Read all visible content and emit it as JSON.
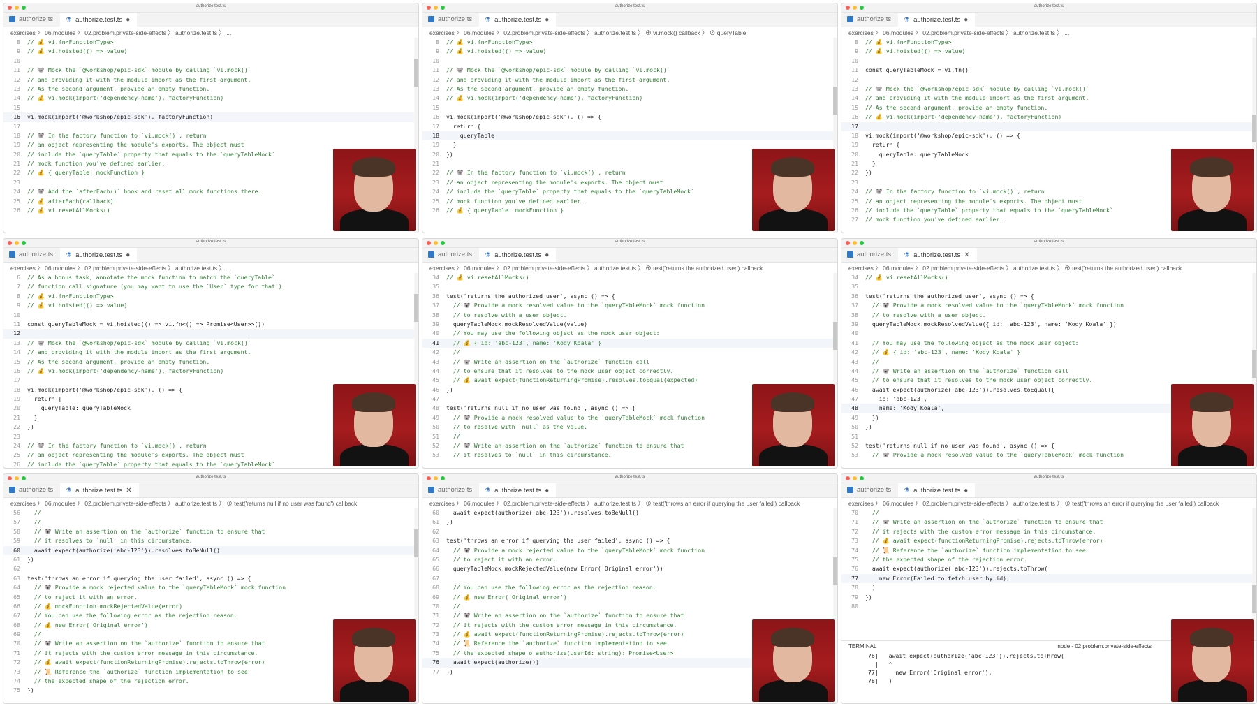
{
  "window_title": "authorize.test.ts",
  "tabs": {
    "file1": "authorize.ts",
    "file2": "authorize.test.ts"
  },
  "breadcrumb_base": "exercises  〉 06.modules  〉 02.problem.private-side-effects  〉  authorize.test.ts  〉 ...",
  "colors": {
    "accent": "#0078d4",
    "comment": "#2e7d32",
    "webcam_bg": "#a61c1e"
  },
  "panels": [
    {
      "breadcrumb": "exercises 〉 06.modules 〉 02.problem.private-side-effects 〉 authorize.test.ts 〉 ...",
      "tab_state": "dirty",
      "current_line": "16",
      "lines": [
        [
          "8",
          "// 💰 vi.fn<FunctionType>"
        ],
        [
          "9",
          "// 💰 vi.hoisted(() => value)"
        ],
        [
          "10",
          ""
        ],
        [
          "11",
          "// 🐨 Mock the `@workshop/epic-sdk` module by calling `vi.mock()`"
        ],
        [
          "12",
          "// and providing it with the module import as the first argument."
        ],
        [
          "13",
          "// As the second argument, provide an empty function."
        ],
        [
          "14",
          "// 💰 vi.mock(import('dependency-name'), factoryFunction)"
        ],
        [
          "15",
          ""
        ],
        [
          "16",
          "vi.mock(import('@workshop/epic-sdk'), factoryFunction)"
        ],
        [
          "17",
          ""
        ],
        [
          "18",
          "// 🐨 In the factory function to `vi.mock()`, return"
        ],
        [
          "19",
          "// an object representing the module's exports. The object must"
        ],
        [
          "20",
          "// include the `queryTable` property that equals to the `queryTableMock`"
        ],
        [
          "21",
          "// mock function you've defined earlier."
        ],
        [
          "22",
          "// 💰 { queryTable: mockFunction }"
        ],
        [
          "23",
          ""
        ],
        [
          "24",
          "// 🐨 Add the `afterEach()` hook and reset all mock functions there."
        ],
        [
          "25",
          "// 💰 afterEach(callback)"
        ],
        [
          "26",
          "// 💰 vi.resetAllMocks()"
        ]
      ]
    },
    {
      "breadcrumb": "exercises 〉 06.modules 〉 02.problem.private-side-effects 〉 authorize.test.ts 〉 ⊕ vi.mock() callback 〉 ⊘ queryTable",
      "tab_state": "dirty",
      "current_line": "18",
      "lines": [
        [
          "8",
          "// 💰 vi.fn<FunctionType>"
        ],
        [
          "9",
          "// 💰 vi.hoisted(() => value)"
        ],
        [
          "10",
          ""
        ],
        [
          "11",
          "// 🐨 Mock the `@workshop/epic-sdk` module by calling `vi.mock()`"
        ],
        [
          "12",
          "// and providing it with the module import as the first argument."
        ],
        [
          "13",
          "// As the second argument, provide an empty function."
        ],
        [
          "14",
          "// 💰 vi.mock(import('dependency-name'), factoryFunction)"
        ],
        [
          "15",
          ""
        ],
        [
          "16",
          "vi.mock(import('@workshop/epic-sdk'), () => {"
        ],
        [
          "17",
          "  return {"
        ],
        [
          "18",
          "    queryTable"
        ],
        [
          "19",
          "  }"
        ],
        [
          "20",
          "})"
        ],
        [
          "21",
          ""
        ],
        [
          "22",
          "// 🐨 In the factory function to `vi.mock()`, return"
        ],
        [
          "23",
          "// an object representing the module's exports. The object must"
        ],
        [
          "24",
          "// include the `queryTable` property that equals to the `queryTableMock`"
        ],
        [
          "25",
          "// mock function you've defined earlier."
        ],
        [
          "26",
          "// 💰 { queryTable: mockFunction }"
        ]
      ]
    },
    {
      "breadcrumb": "exercises 〉 06.modules 〉 02.problem.private-side-effects 〉 authorize.test.ts 〉 ...",
      "tab_state": "dirty",
      "current_line": "17",
      "lines": [
        [
          "8",
          "// 💰 vi.fn<FunctionType>"
        ],
        [
          "9",
          "// 💰 vi.hoisted(() => value)"
        ],
        [
          "10",
          ""
        ],
        [
          "11",
          "const queryTableMock = vi.fn()"
        ],
        [
          "12",
          ""
        ],
        [
          "13",
          "// 🐨 Mock the `@workshop/epic-sdk` module by calling `vi.mock()`"
        ],
        [
          "14",
          "// and providing it with the module import as the first argument."
        ],
        [
          "15",
          "// As the second argument, provide an empty function."
        ],
        [
          "16",
          "// 💰 vi.mock(import('dependency-name'), factoryFunction)"
        ],
        [
          "17",
          ""
        ],
        [
          "18",
          "vi.mock(import('@workshop/epic-sdk'), () => {"
        ],
        [
          "19",
          "  return {"
        ],
        [
          "20",
          "    queryTable: queryTableMock"
        ],
        [
          "21",
          "  }"
        ],
        [
          "22",
          "})"
        ],
        [
          "23",
          ""
        ],
        [
          "24",
          "// 🐨 In the factory function to `vi.mock()`, return"
        ],
        [
          "25",
          "// an object representing the module's exports. The object must"
        ],
        [
          "26",
          "// include the `queryTable` property that equals to the `queryTableMock`"
        ],
        [
          "27",
          "// mock function you've defined earlier."
        ]
      ]
    },
    {
      "breadcrumb": "exercises 〉 06.modules 〉 02.problem.private-side-effects 〉 authorize.test.ts 〉 ...",
      "tab_state": "dirty",
      "current_line": "12",
      "lines": [
        [
          "6",
          "// As a bonus task, annotate the mock function to match the `queryTable`"
        ],
        [
          "7",
          "// function call signature (you may want to use the `User` type for that!)."
        ],
        [
          "8",
          "// 💰 vi.fn<FunctionType>"
        ],
        [
          "9",
          "// 💰 vi.hoisted(() => value)"
        ],
        [
          "10",
          ""
        ],
        [
          "11",
          "const queryTableMock = vi.hoisted(() => vi.fn<() => Promise<User>>())"
        ],
        [
          "12",
          ""
        ],
        [
          "13",
          "// 🐨 Mock the `@workshop/epic-sdk` module by calling `vi.mock()`"
        ],
        [
          "14",
          "// and providing it with the module import as the first argument."
        ],
        [
          "15",
          "// As the second argument, provide an empty function."
        ],
        [
          "16",
          "// 💰 vi.mock(import('dependency-name'), factoryFunction)"
        ],
        [
          "17",
          ""
        ],
        [
          "18",
          "vi.mock(import('@workshop/epic-sdk'), () => {"
        ],
        [
          "19",
          "  return {"
        ],
        [
          "20",
          "    queryTable: queryTableMock"
        ],
        [
          "21",
          "  }"
        ],
        [
          "22",
          "})"
        ],
        [
          "23",
          ""
        ],
        [
          "24",
          "// 🐨 In the factory function to `vi.mock()`, return"
        ],
        [
          "25",
          "// an object representing the module's exports. The object must"
        ],
        [
          "26",
          "// include the `queryTable` property that equals to the `queryTableMock`"
        ]
      ]
    },
    {
      "breadcrumb": "exercises 〉 06.modules 〉 02.problem.private-side-effects 〉 authorize.test.ts 〉 ⊕ test('returns the authorized user') callback",
      "tab_state": "dirty",
      "current_line": "41",
      "lines": [
        [
          "34",
          "// 💰 vi.resetAllMocks()"
        ],
        [
          "35",
          ""
        ],
        [
          "36",
          "test('returns the authorized user', async () => {"
        ],
        [
          "37",
          "  // 🐨 Provide a mock resolved value to the `queryTableMock` mock function"
        ],
        [
          "38",
          "  // to resolve with a user object."
        ],
        [
          "39",
          "  queryTableMock.mockResolvedValue(value)"
        ],
        [
          "40",
          "  // You may use the following object as the mock user object:"
        ],
        [
          "41",
          "  // 💰 { id: 'abc-123', name: 'Kody Koala' }"
        ],
        [
          "42",
          "  //"
        ],
        [
          "43",
          "  // 🐨 Write an assertion on the `authorize` function call"
        ],
        [
          "44",
          "  // to ensure that it resolves to the mock user object correctly."
        ],
        [
          "45",
          "  // 💰 await expect(functionReturningPromise).resolves.toEqual(expected)"
        ],
        [
          "46",
          "})"
        ],
        [
          "47",
          ""
        ],
        [
          "48",
          "test('returns null if no user was found', async () => {"
        ],
        [
          "49",
          "  // 🐨 Provide a mock resolved value to the `queryTableMock` mock function"
        ],
        [
          "50",
          "  // to resolve with `null` as the value."
        ],
        [
          "51",
          "  //"
        ],
        [
          "52",
          "  // 🐨 Write an assertion on the `authorize` function to ensure that"
        ],
        [
          "53",
          "  // it resolves to `null` in this circumstance."
        ]
      ]
    },
    {
      "breadcrumb": "exercises 〉 06.modules 〉 02.problem.private-side-effects 〉 authorize.test.ts 〉 ⊕ test('returns the authorized user') callback",
      "tab_state": "close",
      "current_line": "48",
      "lines": [
        [
          "34",
          "// 💰 vi.resetAllMocks()"
        ],
        [
          "35",
          ""
        ],
        [
          "36",
          "test('returns the authorized user', async () => {"
        ],
        [
          "37",
          "  // 🐨 Provide a mock resolved value to the `queryTableMock` mock function"
        ],
        [
          "38",
          "  // to resolve with a user object."
        ],
        [
          "39",
          "  queryTableMock.mockResolvedValue({ id: 'abc-123', name: 'Kody Koala' })"
        ],
        [
          "40",
          ""
        ],
        [
          "41",
          "  // You may use the following object as the mock user object:"
        ],
        [
          "42",
          "  // 💰 { id: 'abc-123', name: 'Kody Koala' }"
        ],
        [
          "43",
          "  //"
        ],
        [
          "44",
          "  // 🐨 Write an assertion on the `authorize` function call"
        ],
        [
          "45",
          "  // to ensure that it resolves to the mock user object correctly."
        ],
        [
          "46",
          "  await expect(authorize('abc-123')).resolves.toEqual({"
        ],
        [
          "47",
          "    id: 'abc-123',"
        ],
        [
          "48",
          "    name: 'Kody Koala',"
        ],
        [
          "49",
          "  })"
        ],
        [
          "50",
          "})"
        ],
        [
          "51",
          ""
        ],
        [
          "52",
          "test('returns null if no user was found', async () => {"
        ],
        [
          "53",
          "  // 🐨 Provide a mock resolved value to the `queryTableMock` mock function"
        ]
      ]
    },
    {
      "breadcrumb": "exercises 〉 06.modules 〉 02.problem.private-side-effects 〉 authorize.test.ts 〉 ⊕ test('returns null if no user was found') callback",
      "tab_state": "close",
      "current_line": "60",
      "lines": [
        [
          "56",
          "  //"
        ],
        [
          "57",
          "  //"
        ],
        [
          "58",
          "  // 🐨 Write an assertion on the `authorize` function to ensure that"
        ],
        [
          "59",
          "  // it resolves to `null` in this circumstance."
        ],
        [
          "60",
          "  await expect(authorize('abc-123')).resolves.toBeNull()"
        ],
        [
          "61",
          "})"
        ],
        [
          "62",
          ""
        ],
        [
          "63",
          "test('throws an error if querying the user failed', async () => {"
        ],
        [
          "64",
          "  // 🐨 Provide a mock rejected value to the `queryTableMock` mock function"
        ],
        [
          "65",
          "  // to reject it with an error."
        ],
        [
          "66",
          "  // 💰 mockFunction.mockRejectedValue(error)"
        ],
        [
          "67",
          "  // You can use the following error as the rejection reason:"
        ],
        [
          "68",
          "  // 💰 new Error('Original error')"
        ],
        [
          "69",
          "  //"
        ],
        [
          "70",
          "  // 🐨 Write an assertion on the `authorize` function to ensure that"
        ],
        [
          "71",
          "  // it rejects with the custom error message in this circumstance."
        ],
        [
          "72",
          "  // 💰 await expect(functionReturningPromise).rejects.toThrow(error)"
        ],
        [
          "73",
          "  // 📜 Reference the `authorize` function implementation to see"
        ],
        [
          "74",
          "  // the expected shape of the rejection error."
        ],
        [
          "75",
          "})"
        ]
      ]
    },
    {
      "breadcrumb": "exercises 〉 06.modules 〉 02.problem.private-side-effects 〉 authorize.test.ts 〉 ⊕ test('throws an error if querying the user failed') callback",
      "tab_state": "dirty",
      "current_line": "76",
      "lines": [
        [
          "60",
          "  await expect(authorize('abc-123')).resolves.toBeNull()"
        ],
        [
          "61",
          "})"
        ],
        [
          "62",
          ""
        ],
        [
          "63",
          "test('throws an error if querying the user failed', async () => {"
        ],
        [
          "64",
          "  // 🐨 Provide a mock rejected value to the `queryTableMock` mock function"
        ],
        [
          "65",
          "  // to reject it with an error."
        ],
        [
          "66",
          "  queryTableMock.mockRejectedValue(new Error('Original error'))"
        ],
        [
          "67",
          ""
        ],
        [
          "68",
          "  // You can use the following error as the rejection reason:"
        ],
        [
          "69",
          "  // 💰 new Error('Original error')"
        ],
        [
          "70",
          "  //"
        ],
        [
          "71",
          "  // 🐨 Write an assertion on the `authorize` function to ensure that"
        ],
        [
          "72",
          "  // it rejects with the custom error message in this circumstance."
        ],
        [
          "73",
          "  // 💰 await expect(functionReturningPromise).rejects.toThrow(error)"
        ],
        [
          "74",
          "  // 📜 Reference the `authorize` function implementation to see"
        ],
        [
          "75",
          "  // the expected shape o authorize(userId: string): Promise<User>"
        ],
        [
          "76",
          "  await expect(authorize())"
        ],
        [
          "77",
          "})"
        ]
      ]
    },
    {
      "breadcrumb": "exercises 〉 06.modules 〉 02.problem.private-side-effects 〉 authorize.test.ts 〉 ⊕ test('throws an error if querying the user failed') callback",
      "tab_state": "dirty",
      "current_line": "77",
      "lines": [
        [
          "70",
          "  //"
        ],
        [
          "71",
          "  // 🐨 Write an assertion on the `authorize` function to ensure that"
        ],
        [
          "72",
          "  // it rejects with the custom error message in this circumstance."
        ],
        [
          "73",
          "  // 💰 await expect(functionReturningPromise).rejects.toThrow(error)"
        ],
        [
          "74",
          "  // 📜 Reference the `authorize` function implementation to see"
        ],
        [
          "75",
          "  // the expected shape of the rejection error."
        ],
        [
          "76",
          "  await expect(authorize('abc-123')).rejects.toThrow("
        ],
        [
          "77",
          "    new Error(Failed to fetch user by id),"
        ],
        [
          "78",
          "  )"
        ],
        [
          "79",
          "})"
        ],
        [
          "80",
          ""
        ]
      ],
      "terminal": {
        "title": "TERMINAL",
        "process": "node - 02.problem.private-side-effects",
        "lines": [
          "76|   await expect(authorize('abc-123')).rejects.toThrow(",
          "  |   ^",
          "77|     new Error('Original error'),",
          "78|   )"
        ]
      }
    }
  ]
}
